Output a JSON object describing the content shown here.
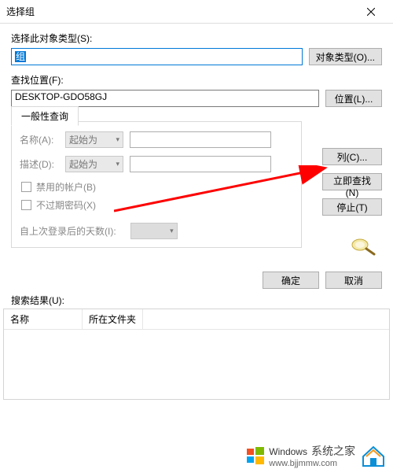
{
  "window": {
    "title": "选择组"
  },
  "section1": {
    "label": "选择此对象类型(S):",
    "value": "组",
    "button": "对象类型(O)..."
  },
  "section2": {
    "label": "查找位置(F):",
    "value": "DESKTOP-GDO58GJ",
    "button": "位置(L)..."
  },
  "tabs": {
    "general": "一般性查询"
  },
  "query": {
    "name_label": "名称(A):",
    "name_mode": "起始为",
    "desc_label": "描述(D):",
    "desc_mode": "起始为",
    "chk_disabled": "禁用的帐户(B)",
    "chk_noexpire": "不过期密码(X)",
    "days_label": "自上次登录后的天数(I):"
  },
  "side": {
    "columns": "列(C)...",
    "findnow": "立即查找(N)",
    "stop": "停止(T)"
  },
  "footer": {
    "ok": "确定",
    "cancel": "取消"
  },
  "results": {
    "label": "搜索结果(U):",
    "col_name": "名称",
    "col_folder": "所在文件夹"
  },
  "branding": {
    "name": "Windows",
    "tagline": "系统之家",
    "url": "www.bjjmmw.com"
  }
}
